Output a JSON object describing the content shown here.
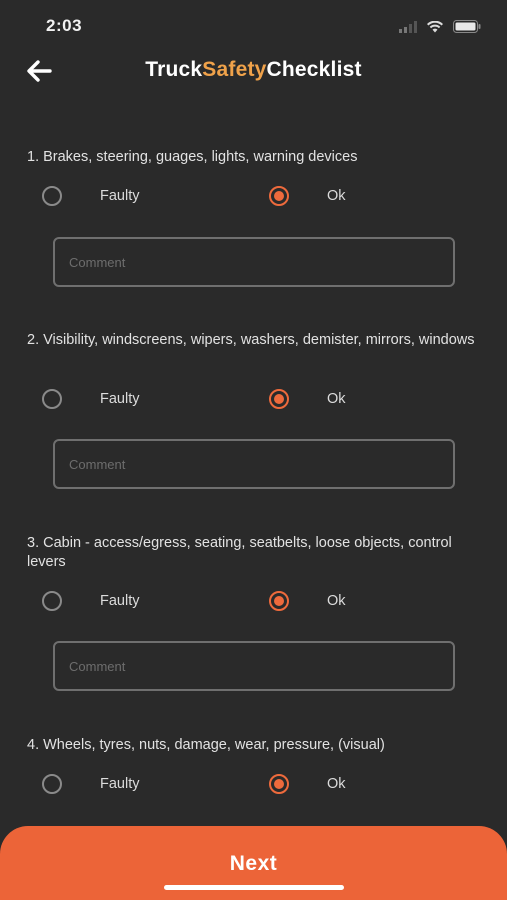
{
  "status_bar": {
    "time": "2:03",
    "icons": [
      "signal-icon",
      "wifi-icon",
      "battery-icon"
    ]
  },
  "header": {
    "title_part1": "Truck",
    "title_part2": "Safety",
    "title_part3": "Checklist",
    "back_icon": "arrow-left-icon"
  },
  "colors": {
    "background": "#2a2a2a",
    "accent": "#ec6438",
    "title_accent": "#f0a24a"
  },
  "checklist": [
    {
      "question": "1. Brakes, steering, guages, lights, warning devices",
      "option_faulty": "Faulty",
      "option_ok": "Ok",
      "selected": "Ok",
      "comment_placeholder": "Comment",
      "comment_value": ""
    },
    {
      "question": "2. Visibility, windscreens, wipers, washers, demister, mirrors, windows",
      "option_faulty": "Faulty",
      "option_ok": "Ok",
      "selected": "Ok",
      "comment_placeholder": "Comment",
      "comment_value": ""
    },
    {
      "question": "3. Cabin - access/egress, seating, seatbelts, loose objects, control levers",
      "option_faulty": "Faulty",
      "option_ok": "Ok",
      "selected": "Ok",
      "comment_placeholder": "Comment",
      "comment_value": ""
    },
    {
      "question": "4. Wheels, tyres, nuts, damage, wear, pressure, (visual)",
      "option_faulty": "Faulty",
      "option_ok": "Ok",
      "selected": "Ok"
    }
  ],
  "footer": {
    "next_label": "Next"
  }
}
